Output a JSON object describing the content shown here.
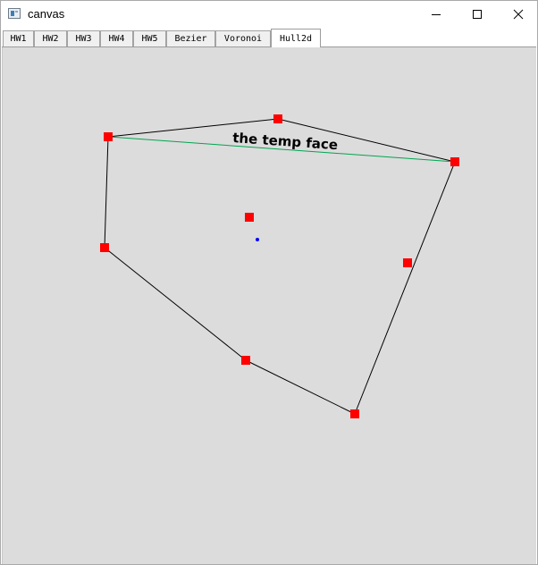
{
  "window": {
    "title": "canvas",
    "app_icon": "app-window-icon",
    "controls": {
      "minimize_icon": "minimize-icon",
      "maximize_icon": "maximize-icon",
      "close_icon": "close-icon"
    }
  },
  "tabs": [
    {
      "label": "HW1",
      "active": false
    },
    {
      "label": "HW2",
      "active": false
    },
    {
      "label": "HW3",
      "active": false
    },
    {
      "label": "HW4",
      "active": false
    },
    {
      "label": "HW5",
      "active": false
    },
    {
      "label": "Bezier",
      "active": false
    },
    {
      "label": "Voronoi",
      "active": false
    },
    {
      "label": "Hull2d",
      "active": true
    }
  ],
  "canvas": {
    "background": "#dcdcdc",
    "point_color": "#ff0000",
    "edge_color": "#000000",
    "temp_face_color": "#00a550",
    "center_color": "#0000ff",
    "temp_face_label": "the temp face"
  }
}
